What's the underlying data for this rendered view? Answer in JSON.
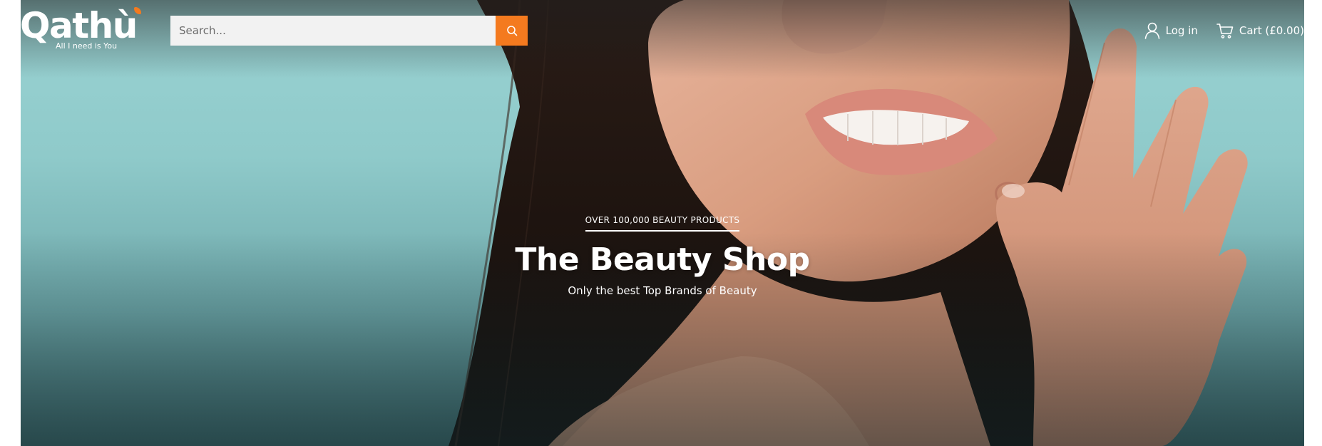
{
  "brand": {
    "name": "Qathù",
    "tagline": "All I need is You",
    "accent_color": "#f47a1f"
  },
  "search": {
    "placeholder": "Search...",
    "value": "",
    "button_icon": "search-icon"
  },
  "header_actions": {
    "login_label": "Log in",
    "login_icon": "user-icon",
    "cart_label": "Cart (£0.00)",
    "cart_icon": "cart-icon"
  },
  "hero": {
    "eyebrow": "OVER 100,000 BEAUTY PRODUCTS",
    "title": "The Beauty Shop",
    "subtitle": "Only the best Top Brands of Beauty",
    "background_color": "#8fcaca"
  }
}
